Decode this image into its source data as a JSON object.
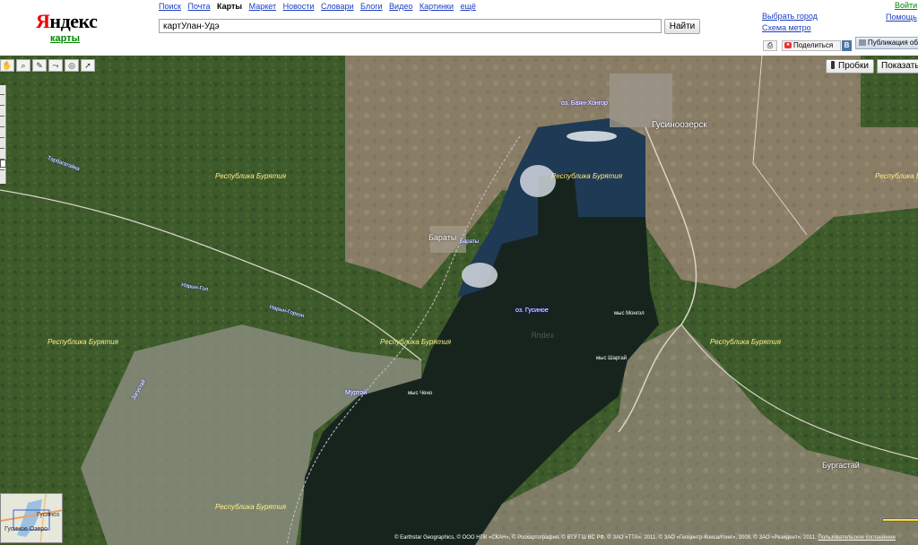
{
  "header": {
    "logo": {
      "brand": "Яндекс",
      "sub": "карты"
    },
    "services": [
      {
        "label": "Поиск",
        "active": false
      },
      {
        "label": "Почта",
        "active": false
      },
      {
        "label": "Карты",
        "active": true
      },
      {
        "label": "Маркет",
        "active": false
      },
      {
        "label": "Новости",
        "active": false
      },
      {
        "label": "Словари",
        "active": false
      },
      {
        "label": "Блоги",
        "active": false
      },
      {
        "label": "Видео",
        "active": false
      },
      {
        "label": "Картинки",
        "active": false
      },
      {
        "label": "ещё",
        "active": false
      }
    ],
    "search": {
      "value": "картУлан-Удэ",
      "button": "Найти"
    },
    "city_link": "Выбрать город",
    "metro_link": "Схема метро",
    "login": "Войти",
    "help": "Помощь",
    "share": "Поделиться",
    "vk": "B",
    "publish": "Публикация обл"
  },
  "map": {
    "traffic_button": "Пробки",
    "show_button": "Показать",
    "watermark": "Яndex",
    "copyright": {
      "text": "© Earthstar Geographics, © ООО НПК «СКАН», © Роскартография, © ВТУ ГШ ВС РФ, © ЗАО «ТТА», 2011, © ЗАО «Геоцентр-Консалтинг», 2009, © ЗАО «Резидент», 2011,",
      "link": "Пользовательское соглашение"
    },
    "colors": {
      "forest": "#3d5a2a",
      "steppe": "#8a7d66",
      "lake": "#17241e",
      "lake_shallow": "#1e3a55",
      "road": "#d8d4c8"
    },
    "labels": {
      "gusinoozersk": "Гусиноозерск",
      "baraty": "Бараты",
      "burgastay": "Бургастай",
      "rep1": "Республика Бурятия",
      "rep2": "Республика Бурятия",
      "rep3": "Республика Бурятия",
      "rep4": "Республика Бурятия",
      "rep5": "Республика Бурятия",
      "rep6": "Республика Бурятия",
      "rep7": "Республика Бурятия",
      "bayan_khongor": "оз. Баян-Хонгор",
      "gusinoe": "оз. Гусиное",
      "mys_murtoy": "Муртой",
      "mys_cheno": "мыс Чено",
      "mys_mongol": "мыс Монгол",
      "mys_2": "мыс Шаргай",
      "baraty_small": "Бараты",
      "stream1": "Тарбагатайка",
      "stream2": "Нарын-Гол",
      "stream3": "Нарын-Горхон",
      "stream4": "Загустай",
      "minimap_city": "Гусиноз",
      "minimap_lake": "Гусиное Озеро"
    }
  }
}
